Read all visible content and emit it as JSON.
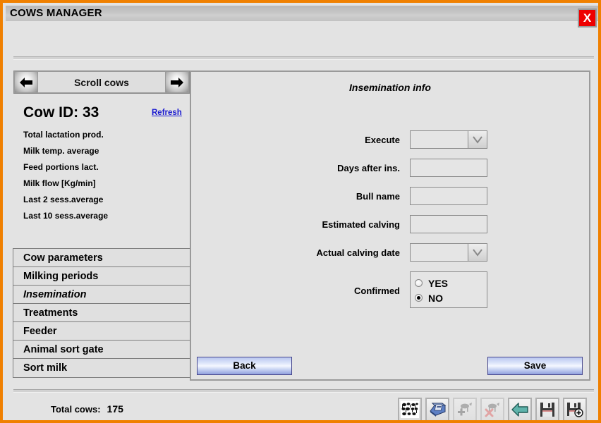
{
  "window": {
    "title": "COWS MANAGER",
    "close_label": "X",
    "accent_color": "#f08000",
    "close_color": "#ee0000"
  },
  "left": {
    "scroll": {
      "label": "Scroll cows",
      "prev_icon": "left-arrow-icon",
      "next_icon": "right-arrow-icon"
    },
    "cow_id_label": "Cow ID: 33",
    "refresh_label": "Refresh",
    "stats": [
      "Total lactation prod.",
      "Milk temp. average",
      "Feed portions lact.",
      "Milk flow [Kg/min]",
      "Last 2 sess.average",
      "Last 10 sess.average"
    ],
    "menu": [
      {
        "label": "Cow parameters",
        "selected": false
      },
      {
        "label": "Milking periods",
        "selected": false
      },
      {
        "label": "Insemination",
        "selected": true
      },
      {
        "label": "Treatments",
        "selected": false
      },
      {
        "label": "Feeder",
        "selected": false
      },
      {
        "label": "Animal sort gate",
        "selected": false
      },
      {
        "label": "Sort milk",
        "selected": false
      }
    ]
  },
  "panel": {
    "title": "Insemination info",
    "fields": [
      {
        "label": "Execute",
        "value": "",
        "type": "combo"
      },
      {
        "label": "Days after ins.",
        "value": "",
        "type": "text"
      },
      {
        "label": "Bull name",
        "value": "",
        "type": "text"
      },
      {
        "label": "Estimated calving",
        "value": "",
        "type": "text"
      },
      {
        "label": "Actual calving date",
        "value": "",
        "type": "combo"
      }
    ],
    "confirmed": {
      "label": "Confirmed",
      "options": [
        {
          "label": "YES",
          "checked": false
        },
        {
          "label": "NO",
          "checked": true
        }
      ]
    },
    "back_label": "Back",
    "save_label": "Save"
  },
  "status": {
    "total_cows_label": "Total cows:",
    "total_cows_value": "175"
  },
  "toolbar": [
    {
      "name": "cow-herd-icon",
      "disabled": false
    },
    {
      "name": "milk-meter-icon",
      "disabled": false
    },
    {
      "name": "add-cow-icon",
      "disabled": true
    },
    {
      "name": "delete-cow-icon",
      "disabled": true
    },
    {
      "name": "back-arrow-icon",
      "disabled": false
    },
    {
      "name": "save-icon",
      "disabled": false
    },
    {
      "name": "save-add-icon",
      "disabled": false
    }
  ]
}
